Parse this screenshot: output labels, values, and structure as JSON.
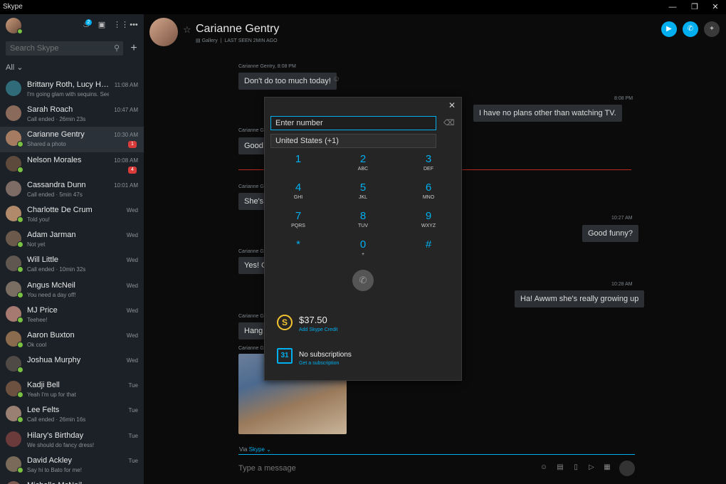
{
  "window": {
    "title": "Skype"
  },
  "sidebar": {
    "search_placeholder": "Search Skype",
    "filter_label": "All",
    "notification_count": "2",
    "contacts": [
      {
        "name": "Brittany Roth, Lucy Holcom...",
        "sub": "I'm going glam with sequins. See y...",
        "time": "11:08 AM",
        "badge": "",
        "avatar_color": "#2f6b78",
        "status": false
      },
      {
        "name": "Sarah Roach",
        "sub": "Call ended · 26min 23s",
        "time": "10:47 AM",
        "badge": "",
        "avatar_color": "#8a6a5a",
        "status": false
      },
      {
        "name": "Carianne Gentry",
        "sub": "Shared a photo",
        "time": "10:30 AM",
        "badge": "1",
        "avatar_color": "#a57c62",
        "status": true
      },
      {
        "name": "Nelson Morales",
        "sub": "",
        "time": "10:08 AM",
        "badge": "4",
        "avatar_color": "#5d4a3c",
        "status": true
      },
      {
        "name": "Cassandra Dunn",
        "sub": "Call ended · 5min 47s",
        "time": "10:01 AM",
        "badge": "",
        "avatar_color": "#7d6b66",
        "status": false
      },
      {
        "name": "Charlotte De Crum",
        "sub": "Told you!",
        "time": "Wed",
        "badge": "",
        "avatar_color": "#b08a6b",
        "status": true
      },
      {
        "name": "Adam Jarman",
        "sub": "Not yet",
        "time": "Wed",
        "badge": "",
        "avatar_color": "#6b5a4c",
        "status": true
      },
      {
        "name": "Will Little",
        "sub": "Call ended · 10min 32s",
        "time": "Wed",
        "badge": "",
        "avatar_color": "#5f5750",
        "status": true
      },
      {
        "name": "Angus McNeil",
        "sub": "You need a day off!",
        "time": "Wed",
        "badge": "",
        "avatar_color": "#7a6e62",
        "status": true
      },
      {
        "name": "MJ Price",
        "sub": "Teehee!",
        "time": "Wed",
        "badge": "",
        "avatar_color": "#a67a70",
        "status": true
      },
      {
        "name": "Aaron Buxton",
        "sub": "Ok cool",
        "time": "Wed",
        "badge": "",
        "avatar_color": "#8b6b4e",
        "status": true
      },
      {
        "name": "Joshua Murphy",
        "sub": "",
        "time": "Wed",
        "badge": "",
        "avatar_color": "#4f4a45",
        "status": true
      },
      {
        "name": "Kadji Bell",
        "sub": "Yeah I'm up for that",
        "time": "Tue",
        "badge": "",
        "avatar_color": "#6c5040",
        "status": true
      },
      {
        "name": "Lee Felts",
        "sub": "Call ended · 26min 16s",
        "time": "Tue",
        "badge": "",
        "avatar_color": "#9a7f73",
        "status": true
      },
      {
        "name": "Hilary's Birthday",
        "sub": "We should do fancy dress!",
        "time": "Tue",
        "badge": "",
        "avatar_color": "#6b3a3a",
        "status": false
      },
      {
        "name": "David Ackley",
        "sub": "Say hi to Bato for me!",
        "time": "Tue",
        "badge": "",
        "avatar_color": "#7a6a5a",
        "status": true
      },
      {
        "name": "Michelle McNeil",
        "sub": "",
        "time": "",
        "badge": "",
        "avatar_color": "#7a5a50",
        "status": true
      }
    ]
  },
  "chat": {
    "contact_name": "Carianne Gentry",
    "gallery_label": "Gallery",
    "last_seen": "LAST SEEN 2MIN AGO",
    "messages": [
      {
        "meta": "Carianne Gentry, 8:08 PM",
        "text": "Don't do too much today!"
      },
      {
        "meta": "8:08 PM",
        "text": "I have no plans other than watching TV."
      },
      {
        "meta": "Carianne G",
        "text": "Good!"
      },
      {
        "meta": "Carianne G",
        "text": "She's i"
      },
      {
        "meta": "10:27 AM",
        "text": "Good funny?"
      },
      {
        "meta": "Carianne G",
        "text": "Yes! Ch"
      },
      {
        "meta": "10:28 AM",
        "text": "Ha! Awwm she's really growing up"
      },
      {
        "meta": "Carianne G",
        "text": "Hang o"
      },
      {
        "meta": "Carianne G",
        "text": ""
      }
    ],
    "via_label": "Via",
    "via_link": "Skype",
    "compose_placeholder": "Type a message"
  },
  "dialpad": {
    "number_placeholder": "Enter number",
    "country": "United States (+1)",
    "keys": [
      {
        "digit": "1",
        "letters": ""
      },
      {
        "digit": "2",
        "letters": "ABC"
      },
      {
        "digit": "3",
        "letters": "DEF"
      },
      {
        "digit": "4",
        "letters": "GHI"
      },
      {
        "digit": "5",
        "letters": "JKL"
      },
      {
        "digit": "6",
        "letters": "MNO"
      },
      {
        "digit": "7",
        "letters": "PQRS"
      },
      {
        "digit": "8",
        "letters": "TUV"
      },
      {
        "digit": "9",
        "letters": "WXYZ"
      },
      {
        "digit": "*",
        "letters": ""
      },
      {
        "digit": "0",
        "letters": "+"
      },
      {
        "digit": "#",
        "letters": ""
      }
    ],
    "credit_amount": "$37.50",
    "credit_link": "Add Skype Credit",
    "subscriptions_title": "No subscriptions",
    "subscriptions_link": "Get a subscription",
    "calendar_day": "31"
  },
  "colors": {
    "accent": "#00aff0",
    "online": "#7ac143",
    "badge": "#d93b3b",
    "credit": "#f4c430"
  }
}
